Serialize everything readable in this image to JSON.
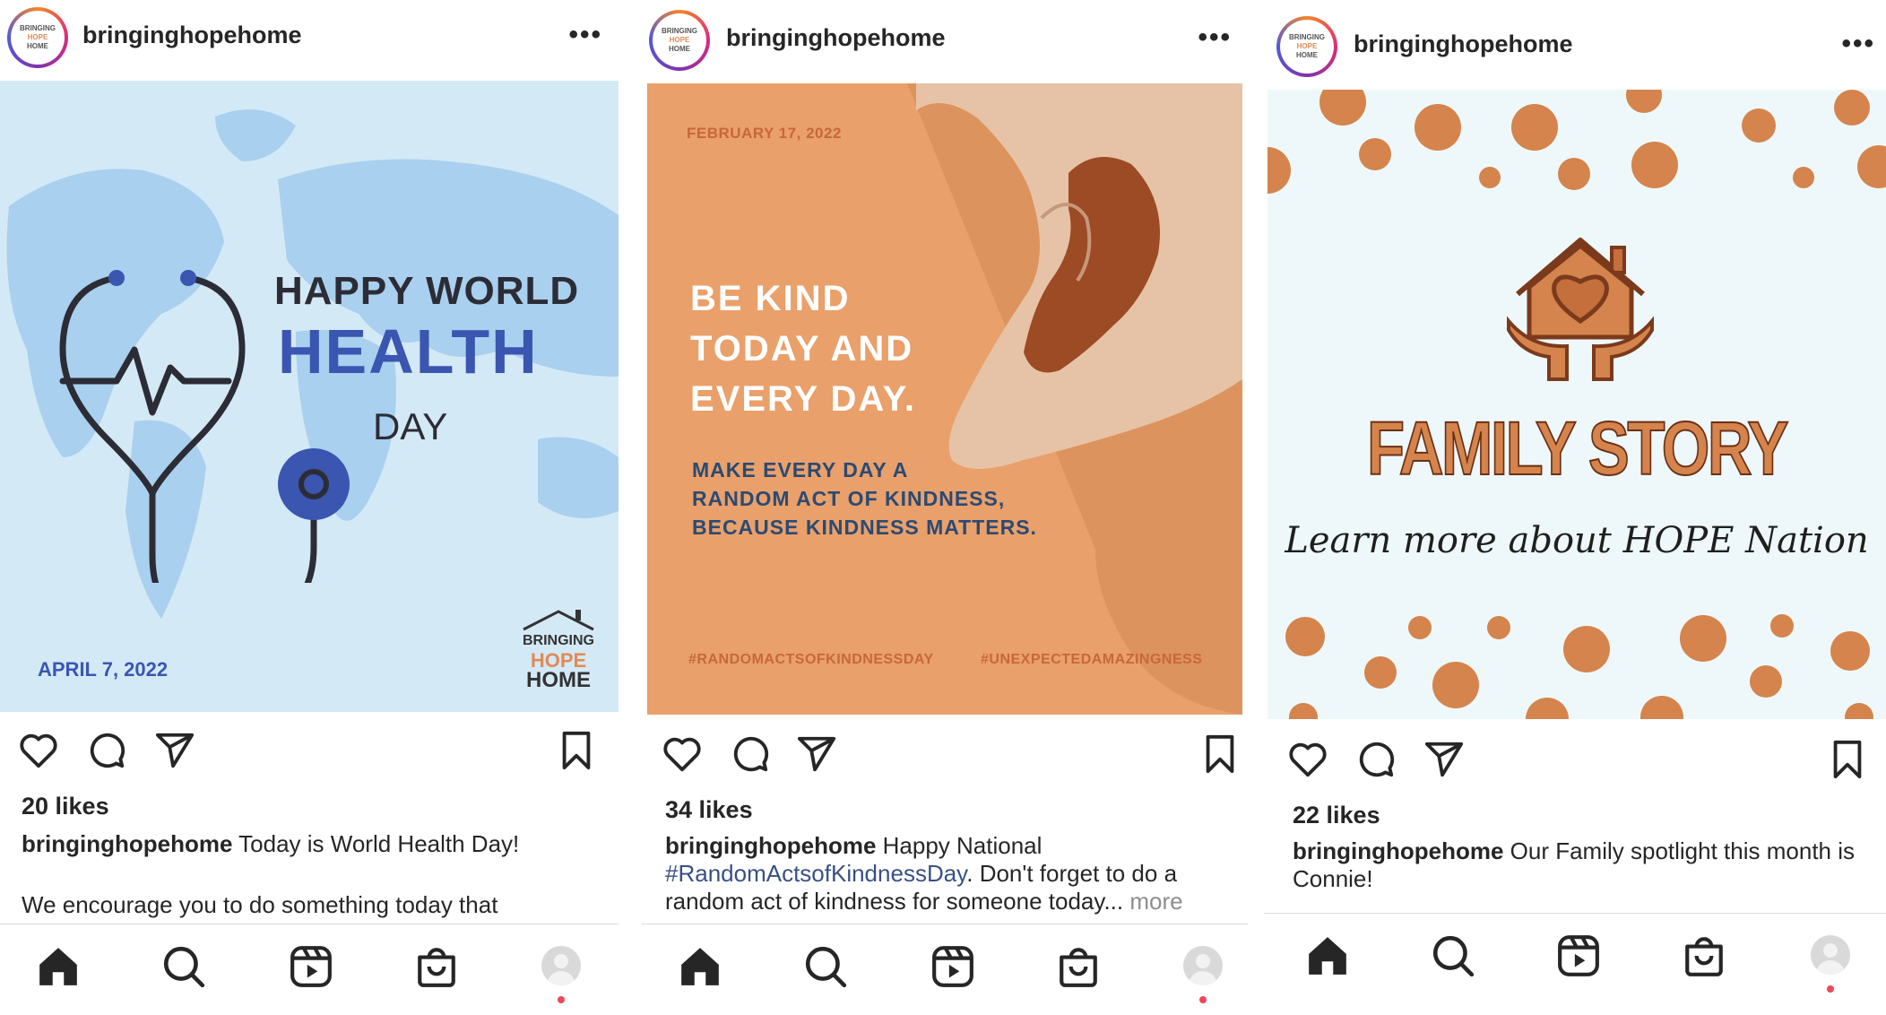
{
  "posts": [
    {
      "username": "bringinghopehome",
      "logo": {
        "l1": "BRINGING",
        "l2": "HOPE",
        "l3": "HOME"
      },
      "image": {
        "line1": "HAPPY WORLD",
        "line2": "HEALTH",
        "line3": "DAY",
        "date": "APRIL 7, 2022",
        "brand": {
          "l1": "BRINGING",
          "l2": "HOPE",
          "l3": "HOME"
        }
      },
      "likes": "20 likes",
      "caption_user": "bringinghopehome",
      "caption_text": " Today is World Health Day!",
      "caption_extra": "We encourage you to do something today that"
    },
    {
      "username": "bringinghopehome",
      "logo": {
        "l1": "BRINGING",
        "l2": "HOPE",
        "l3": "HOME"
      },
      "image": {
        "date": "FEBRUARY 17, 2022",
        "h1": "BE KIND",
        "h2": "TODAY AND",
        "h3": "EVERY DAY.",
        "s1": "MAKE EVERY DAY A",
        "s2": "RANDOM ACT OF KINDNESS,",
        "s3": "BECAUSE KINDNESS MATTERS.",
        "tag1": "#RANDOMACTSOFKINDNESSDAY",
        "tag2": "#UNEXPECTEDAMAZINGNESS"
      },
      "likes": "34 likes",
      "caption_user": "bringinghopehome",
      "caption_text": " Happy National",
      "caption_tag": "#RandomActsofKindnessDay",
      "caption_text2": ". Don't forget to do a random act of kindness for someone today...",
      "caption_more": " more"
    },
    {
      "username": "bringinghopehome",
      "logo": {
        "l1": "BRINGING",
        "l2": "HOPE",
        "l3": "HOME"
      },
      "image": {
        "title": "FAMILY STORY",
        "subtitle": "Learn more about HOPE Nation"
      },
      "likes": "22 likes",
      "caption_user": "bringinghopehome",
      "caption_text": " Our Family spotlight this month is Connie!"
    }
  ],
  "icons": {
    "like": "heart-icon",
    "comment": "comment-icon",
    "share": "send-icon",
    "save": "bookmark-icon",
    "home": "home-icon",
    "search": "search-icon",
    "reels": "reels-icon",
    "shop": "shop-icon",
    "profile": "profile-icon"
  },
  "colors": {
    "accent_orange": "#e9a06a",
    "dot_orange": "#d4844c",
    "health_blue": "#3a56b0",
    "sky": "#d6ebf7",
    "notif": "#ed4956"
  }
}
